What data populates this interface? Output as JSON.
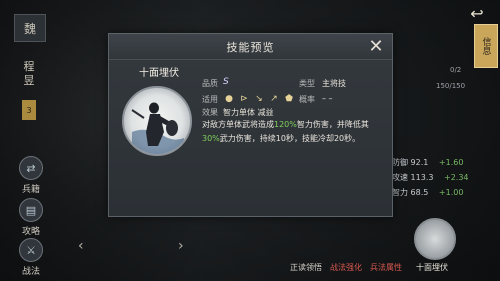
{
  "left_rail": {
    "top_glyph": "魏",
    "vertical_text": "程昱",
    "badge": "3",
    "buttons": [
      {
        "label": "兵籍",
        "icon": "swap-icon"
      },
      {
        "label": "攻略",
        "icon": "book-icon"
      },
      {
        "label": "战法",
        "icon": "sword-icon"
      }
    ]
  },
  "top_right": {
    "back_icon": "back-arrow-icon",
    "side_tab": "信息"
  },
  "right_panel": {
    "counter_a": "0/2",
    "counter_b": "150/150",
    "stats": [
      {
        "label": "防御",
        "value": "92.1",
        "plus": "+1.60"
      },
      {
        "label": "攻速",
        "value": "113.3",
        "plus": "+2.34"
      },
      {
        "label": "智力",
        "value": "68.5",
        "plus": "+1.00"
      }
    ]
  },
  "bottom": {
    "labels": [
      {
        "text": "正读领悟",
        "color": "#d9d5cb"
      },
      {
        "text": "战法强化",
        "color": "#d9584f"
      },
      {
        "text": "兵法属性",
        "color": "#d9584f"
      },
      {
        "text": "十面埋伏",
        "color": "#e9e5da"
      }
    ]
  },
  "popup": {
    "title": "技能预览",
    "skill_name": "十面埋伏",
    "quality_label": "品质",
    "quality_value": "S",
    "type_label": "类型",
    "type_value": "主将技",
    "applicable_label": "适用",
    "probability_label": "概率",
    "probability_value": "– –",
    "effect_label": "效果",
    "effect_value": "智力单体  减益",
    "desc_parts": {
      "p1": "对敌方单体武将造成",
      "p2": "120%",
      "p3": "智力伤害，并降低其",
      "p4": "30%",
      "p5": "武力伤害，持续10秒，技能冷却20秒。"
    },
    "applicable_icons": [
      "●",
      "⊳",
      "↘",
      "↗",
      "⬟"
    ]
  },
  "colors": {
    "highlight_green": "#7fcf5c",
    "accent_gold": "#c9a65a"
  }
}
